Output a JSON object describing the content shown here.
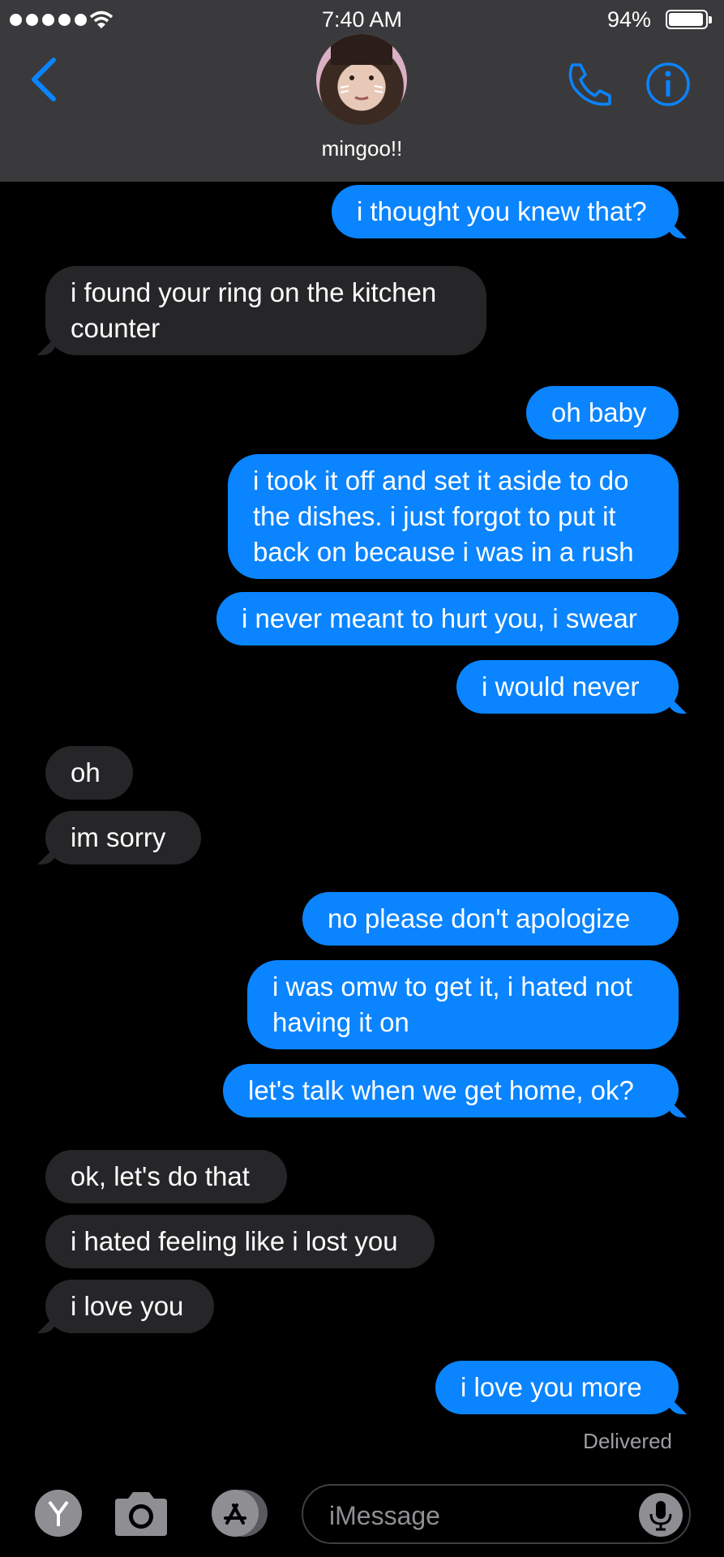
{
  "status_bar": {
    "time": "7:40 AM",
    "battery": "94%"
  },
  "contact": {
    "name": "mingoo!!"
  },
  "messages": [
    {
      "text": "i thought you knew that?",
      "side": "out"
    },
    {
      "text": "i found your ring on the kitchen\ncounter",
      "side": "in"
    },
    {
      "text": "oh baby",
      "side": "out"
    },
    {
      "text": "i took it off and set it aside to do\nthe dishes. i just forgot to put it\nback on because i was in a rush",
      "side": "out"
    },
    {
      "text": "i never meant to hurt you, i swear",
      "side": "out"
    },
    {
      "text": "i would never",
      "side": "out"
    },
    {
      "text": "oh",
      "side": "in"
    },
    {
      "text": "im sorry",
      "side": "in"
    },
    {
      "text": "no please don't apologize",
      "side": "out"
    },
    {
      "text": "i was omw to get it, i hated not\nhaving it on",
      "side": "out"
    },
    {
      "text": "let's talk when we get home, ok?",
      "side": "out"
    },
    {
      "text": "ok, let's do that",
      "side": "in"
    },
    {
      "text": "i hated feeling like i lost you",
      "side": "in"
    },
    {
      "text": "i love you",
      "side": "in"
    },
    {
      "text": "i love you more",
      "side": "out"
    }
  ],
  "delivered_label": "Delivered",
  "composer": {
    "placeholder": "iMessage"
  },
  "icons": [
    "back-chevron-icon",
    "phone-icon",
    "info-icon",
    "camera-icon",
    "app-store-icon",
    "microphone-icon",
    "wifi-icon"
  ],
  "accent_color": "#0a84ff"
}
